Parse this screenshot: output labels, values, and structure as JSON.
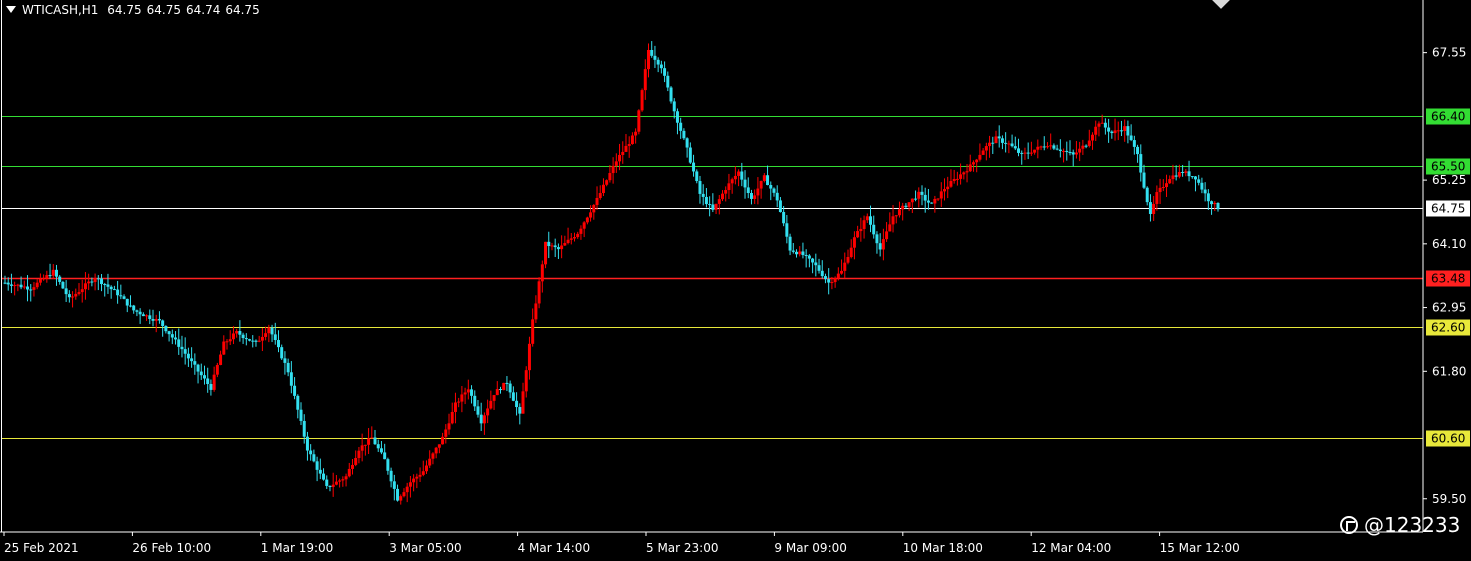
{
  "header": {
    "symbol": "WTICASH,H1",
    "open": "64.75",
    "high": "64.75",
    "low": "64.74",
    "close": "64.75"
  },
  "watermark": "@123233",
  "colors": {
    "background": "#000000",
    "bull": "#ff0000",
    "bear": "#33e0f0",
    "green_level": "#33dd33",
    "red_level": "#ff2020",
    "yellow_level": "#e8e83a",
    "current_level": "#ffffff",
    "axis": "#ffffff"
  },
  "chart_data": {
    "type": "candlestick",
    "symbol": "WTICASH,H1",
    "ylim": [
      58.9,
      68.5
    ],
    "yticks": [
      "67.55",
      "65.25",
      "64.10",
      "62.95",
      "61.80",
      "59.50"
    ],
    "x_labels": [
      "25 Feb 2021",
      "26 Feb 10:00",
      "1 Mar 19:00",
      "3 Mar 05:00",
      "4 Mar 14:00",
      "5 Mar 23:00",
      "9 Mar 09:00",
      "10 Mar 18:00",
      "12 Mar 04:00",
      "15 Mar 12:00"
    ],
    "levels": [
      {
        "value": 66.4,
        "label": "66.40",
        "kind": "green"
      },
      {
        "value": 65.5,
        "label": "65.50",
        "kind": "green"
      },
      {
        "value": 64.75,
        "label": "64.75",
        "kind": "current"
      },
      {
        "value": 63.48,
        "label": "63.48",
        "kind": "red"
      },
      {
        "value": 62.6,
        "label": "62.60",
        "kind": "yellow"
      },
      {
        "value": 60.6,
        "label": "60.60",
        "kind": "yellow"
      }
    ],
    "path_points": [
      [
        0,
        63.4
      ],
      [
        8,
        63.3
      ],
      [
        15,
        63.6
      ],
      [
        20,
        63.1
      ],
      [
        28,
        63.5
      ],
      [
        35,
        63.2
      ],
      [
        40,
        62.9
      ],
      [
        48,
        62.7
      ],
      [
        55,
        62.2
      ],
      [
        60,
        61.8
      ],
      [
        64,
        61.5
      ],
      [
        68,
        62.3
      ],
      [
        72,
        62.5
      ],
      [
        78,
        62.3
      ],
      [
        82,
        62.6
      ],
      [
        88,
        61.8
      ],
      [
        94,
        60.4
      ],
      [
        100,
        59.7
      ],
      [
        106,
        59.9
      ],
      [
        110,
        60.4
      ],
      [
        114,
        60.6
      ],
      [
        118,
        60.2
      ],
      [
        122,
        59.5
      ],
      [
        126,
        59.8
      ],
      [
        130,
        60.0
      ],
      [
        136,
        60.6
      ],
      [
        140,
        61.2
      ],
      [
        144,
        61.5
      ],
      [
        148,
        60.9
      ],
      [
        152,
        61.4
      ],
      [
        156,
        61.6
      ],
      [
        160,
        61.0
      ],
      [
        164,
        62.7
      ],
      [
        168,
        64.1
      ],
      [
        172,
        64.0
      ],
      [
        178,
        64.3
      ],
      [
        184,
        64.9
      ],
      [
        190,
        65.6
      ],
      [
        196,
        66.1
      ],
      [
        200,
        67.6
      ],
      [
        204,
        67.3
      ],
      [
        208,
        66.5
      ],
      [
        212,
        65.8
      ],
      [
        216,
        65.0
      ],
      [
        220,
        64.7
      ],
      [
        224,
        65.1
      ],
      [
        228,
        65.4
      ],
      [
        232,
        64.9
      ],
      [
        236,
        65.3
      ],
      [
        240,
        64.9
      ],
      [
        244,
        64.0
      ],
      [
        248,
        63.9
      ],
      [
        252,
        63.7
      ],
      [
        256,
        63.4
      ],
      [
        260,
        63.6
      ],
      [
        264,
        64.2
      ],
      [
        268,
        64.6
      ],
      [
        272,
        64.0
      ],
      [
        276,
        64.6
      ],
      [
        280,
        64.8
      ],
      [
        284,
        65.0
      ],
      [
        288,
        64.8
      ],
      [
        292,
        65.1
      ],
      [
        296,
        65.3
      ],
      [
        300,
        65.5
      ],
      [
        304,
        65.8
      ],
      [
        308,
        66.0
      ],
      [
        312,
        65.9
      ],
      [
        316,
        65.7
      ],
      [
        320,
        65.8
      ],
      [
        324,
        65.9
      ],
      [
        328,
        65.8
      ],
      [
        332,
        65.7
      ],
      [
        336,
        65.9
      ],
      [
        340,
        66.3
      ],
      [
        344,
        66.1
      ],
      [
        348,
        66.2
      ],
      [
        352,
        65.7
      ],
      [
        356,
        64.6
      ],
      [
        358,
        65.0
      ],
      [
        362,
        65.3
      ],
      [
        366,
        65.4
      ],
      [
        370,
        65.3
      ],
      [
        374,
        64.9
      ],
      [
        377,
        64.75
      ]
    ],
    "x_range": [
      0,
      377
    ]
  }
}
